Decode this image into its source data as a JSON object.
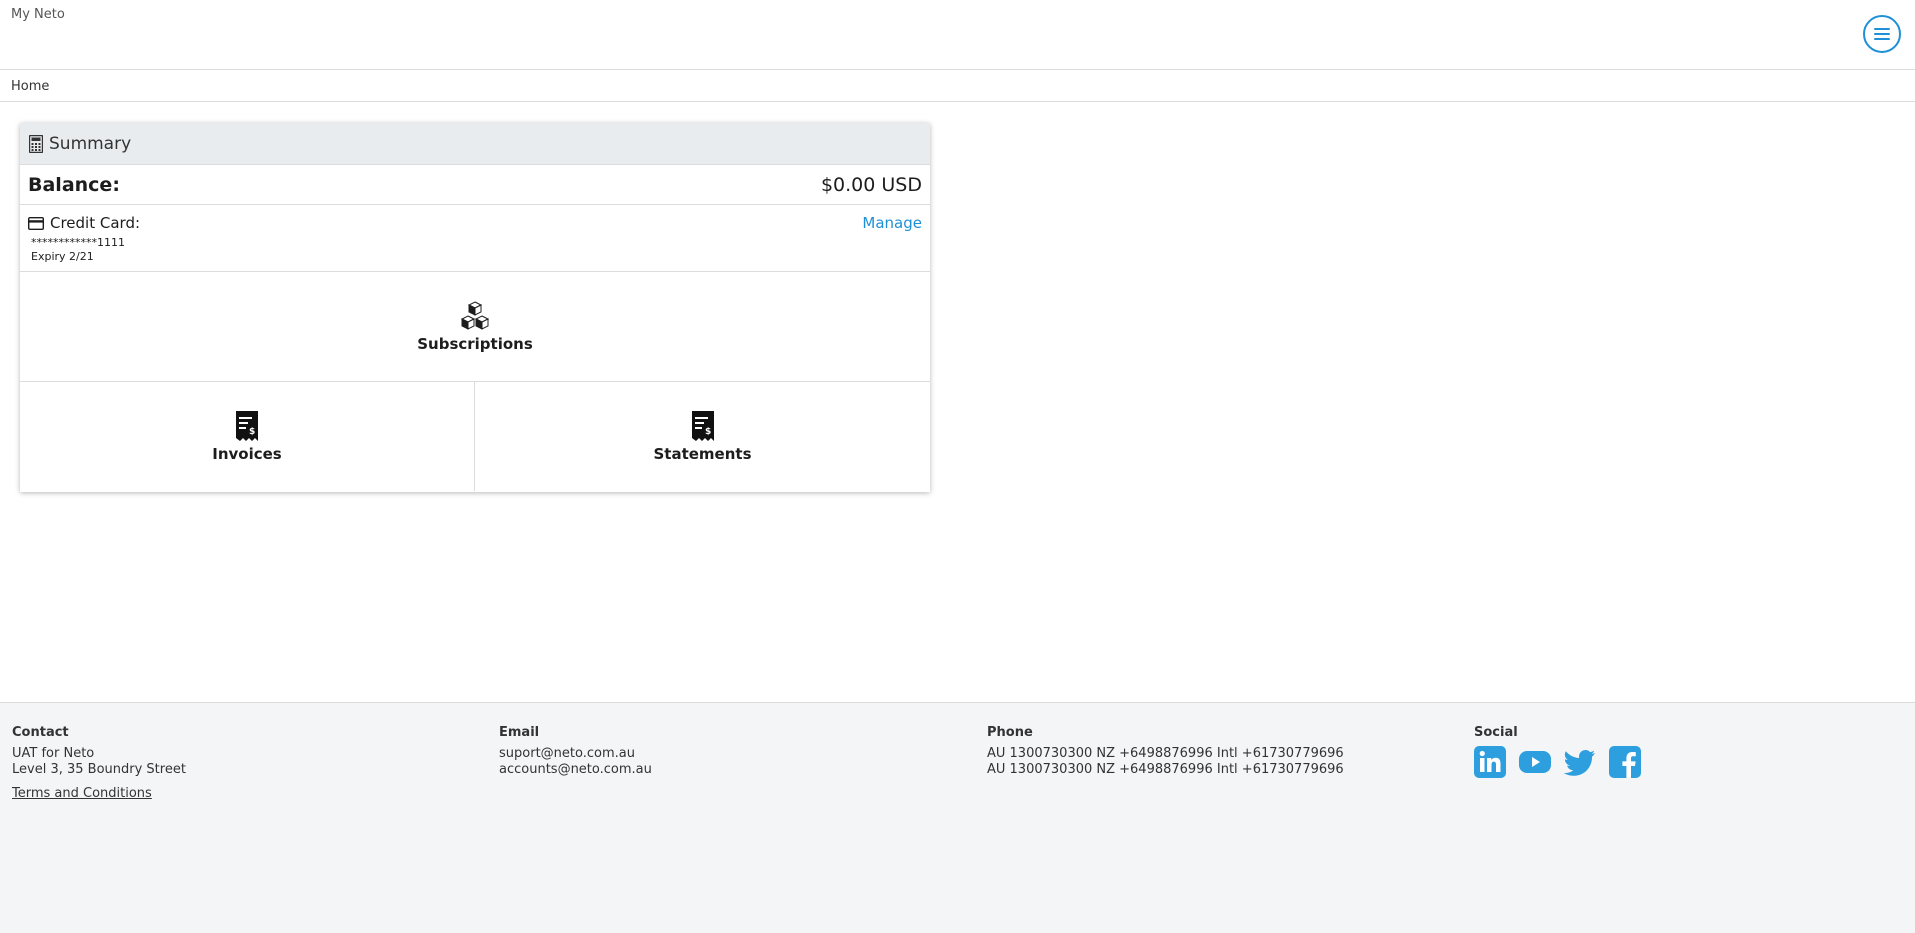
{
  "header": {
    "brand": "My Neto",
    "menu_icon": "hamburger-menu-icon"
  },
  "breadcrumb": {
    "home": "Home"
  },
  "summary": {
    "title": "Summary",
    "balance_label": "Balance:",
    "balance_value": "$0.00 USD",
    "credit_card_label": "Credit Card:",
    "card_number": "************1111",
    "expiry": "Expiry 2/21",
    "manage_label": "Manage"
  },
  "tiles": {
    "subscriptions": "Subscriptions",
    "invoices": "Invoices",
    "statements": "Statements"
  },
  "footer": {
    "contact": {
      "heading": "Contact",
      "line1": "UAT for Neto",
      "line2": "Level 3, 35 Boundry Street",
      "terms": "Terms and Conditions"
    },
    "email": {
      "heading": "Email",
      "line1": "suport@neto.com.au",
      "line2": "accounts@neto.com.au"
    },
    "phone": {
      "heading": "Phone",
      "line1": "AU 1300730300 NZ +6498876996 Intl +61730779696",
      "line2": "AU 1300730300 NZ +6498876996 Intl +61730779696"
    },
    "social": {
      "heading": "Social",
      "icons": [
        "linkedin-icon",
        "youtube-icon",
        "twitter-icon",
        "facebook-icon"
      ]
    }
  },
  "colors": {
    "accent": "#1e90d6",
    "social": "#2d9fde",
    "header_bg": "#e9ecef",
    "footer_bg": "#f4f5f7"
  }
}
